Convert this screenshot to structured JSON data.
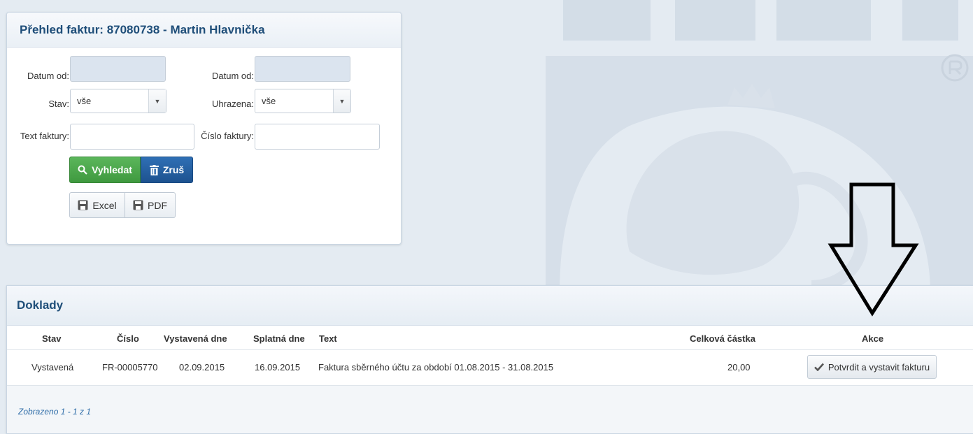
{
  "filter": {
    "title": "Přehled faktur: 87080738 - Martin Hlavnička",
    "date_from_label": "Datum od:",
    "date_from2_label": "Datum od:",
    "status_label": "Stav:",
    "status_value": "vše",
    "paid_label": "Uhrazena:",
    "paid_value": "vše",
    "text_label": "Text faktury:",
    "number_label": "Číslo faktury:",
    "search_label": "Vyhledat",
    "reset_label": "Zruš",
    "excel_label": "Excel",
    "pdf_label": "PDF"
  },
  "docs": {
    "title": "Doklady",
    "columns": {
      "stav": "Stav",
      "cislo": "Číslo",
      "vystavena": "Vystavená dne",
      "splatna": "Splatná dne",
      "text": "Text",
      "castka": "Celková částka",
      "akce": "Akce"
    },
    "rows": [
      {
        "stav": "Vystavená",
        "cislo": "FR-00005770",
        "vystavena": "02.09.2015",
        "splatna": "16.09.2015",
        "text": "Faktura sběrného účtu za období 01.08.2015 - 31.08.2015",
        "castka": "20,00",
        "action_label": "Potvrdit a vystavit fakturu"
      }
    ],
    "pager": "Zobrazeno 1 - 1 z 1"
  },
  "icons": {
    "search": "search-icon",
    "reset": "trash-icon",
    "excel": "save-icon",
    "pdf": "save-icon",
    "confirm": "checkmark-icon",
    "arrow": "down-arrow-icon",
    "background": "lion-emblem"
  },
  "colors": {
    "primary_green": "#47a447",
    "primary_blue": "#2463a8",
    "heading_blue": "#1f4e79",
    "page_bg": "#e4ebf2"
  }
}
